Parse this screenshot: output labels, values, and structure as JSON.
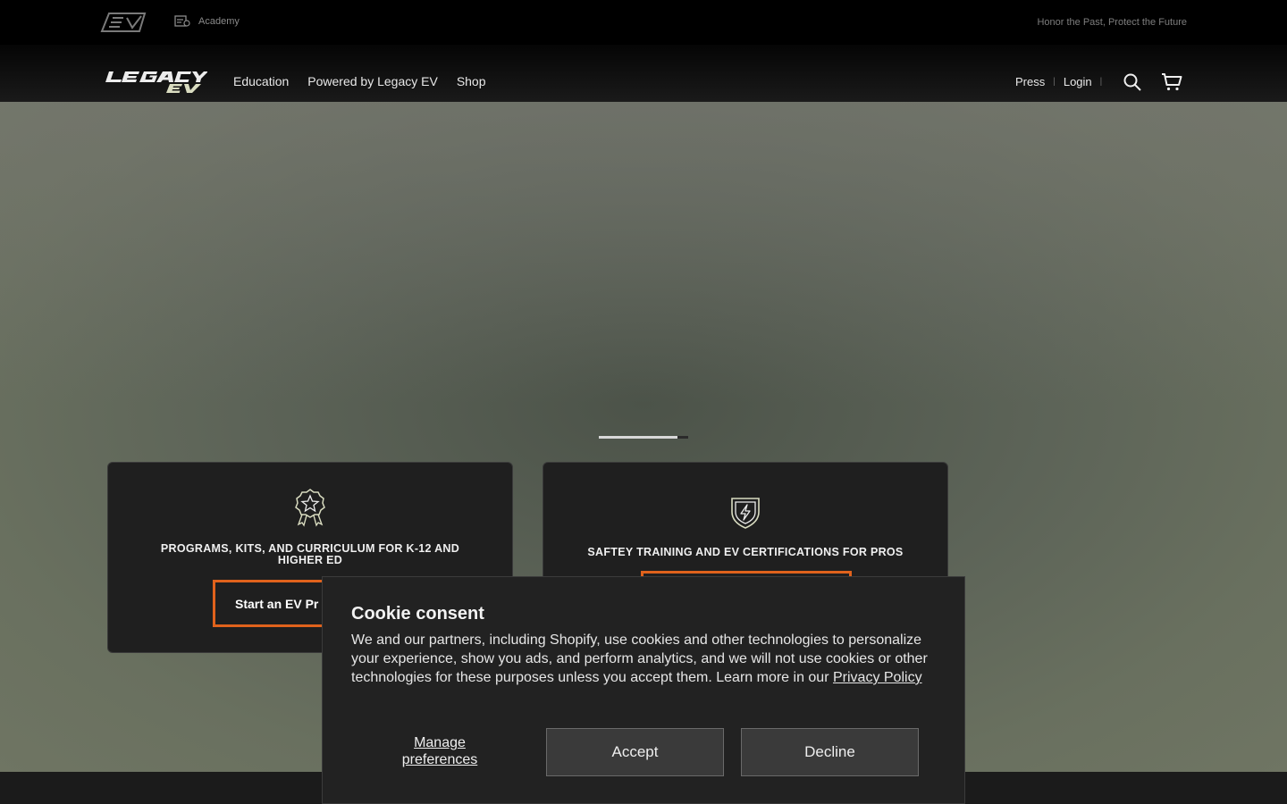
{
  "topbar": {
    "academy_label": "Academy",
    "tagline": "Honor the Past, Protect the Future"
  },
  "nav": {
    "links": [
      "Education",
      "Powered by Legacy EV",
      "Shop"
    ],
    "press": "Press",
    "login": "Login",
    "separator": "|"
  },
  "hero": {
    "slider_progress": 0.88
  },
  "cards": [
    {
      "title": "PROGRAMS, KITS, AND CURRICULUM FOR K-12 AND HIGHER ED",
      "cta": "Start an EV Pr",
      "icon": "award-ribbon-icon"
    },
    {
      "title": "SAFTEY TRAINING AND EV CERTIFICATIONS FOR PROS",
      "cta": "",
      "icon": "shield-bolt-icon"
    }
  ],
  "cookie": {
    "title": "Cookie consent",
    "body": "We and our partners, including Shopify, use cookies and other technologies to personalize your experience, show you ads, and perform analytics, and we will not use cookies or other technologies for these purposes unless you accept them. Learn more in our ",
    "policy_link": "Privacy Policy",
    "manage": "Manage preferences",
    "accept": "Accept",
    "decline": "Decline"
  },
  "colors": {
    "accent": "#e0621c",
    "brand_tint": "#d9dcc0"
  }
}
